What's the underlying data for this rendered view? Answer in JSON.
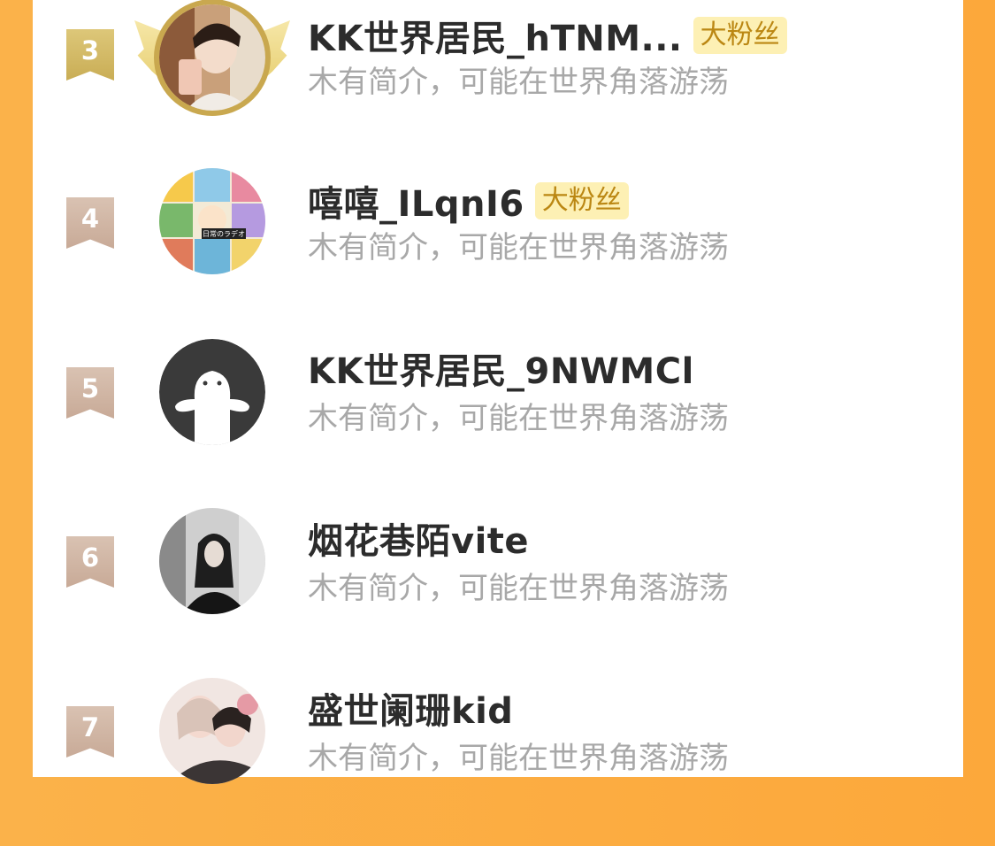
{
  "list": [
    {
      "rank": "3",
      "name": "KK世界居民_hTNM...",
      "badge": "大粉丝",
      "bio": "木有简介，可能在世界角落游荡"
    },
    {
      "rank": "4",
      "name": "嘻嘻_ILqnI6",
      "badge": "大粉丝",
      "bio": "木有简介，可能在世界角落游荡",
      "avatar_caption": "日常のラデオ"
    },
    {
      "rank": "5",
      "name": "KK世界居民_9NWMCl",
      "badge": "",
      "bio": "木有简介，可能在世界角落游荡"
    },
    {
      "rank": "6",
      "name": "烟花巷陌vite",
      "badge": "",
      "bio": "木有简介，可能在世界角落游荡"
    },
    {
      "rank": "7",
      "name": "盛世阑珊kid",
      "badge": "",
      "bio": "木有简介，可能在世界角落游荡"
    }
  ],
  "colors": {
    "background_orange": "#fbb24a",
    "rank_gold": "#d8c06c",
    "rank_plain": "#d2b8a6",
    "badge_bg": "#fdf0b4",
    "badge_text": "#bb8713",
    "name_text": "#2c2c2c",
    "bio_text": "#a8a8a8"
  }
}
